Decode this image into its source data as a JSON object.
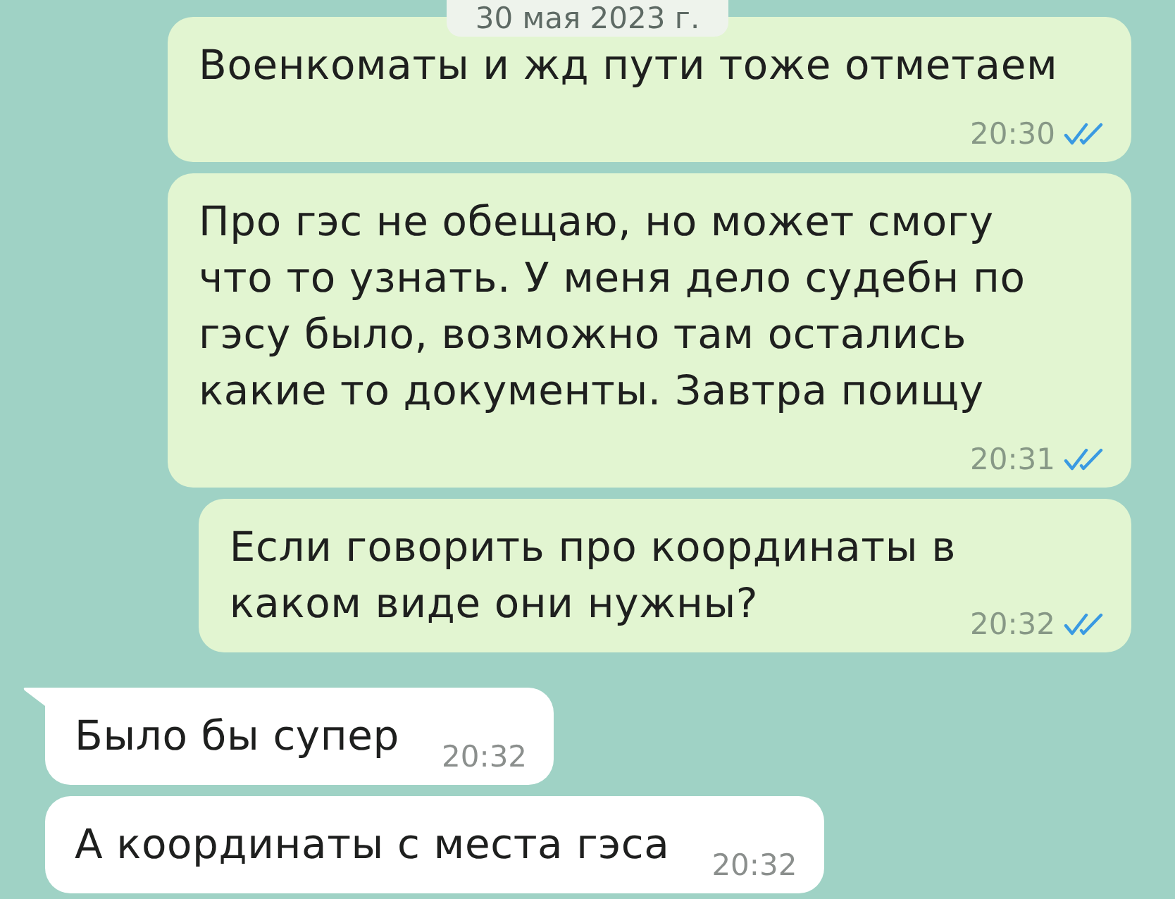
{
  "date_chip": {
    "text": "30 мая 2023 г."
  },
  "messages": [
    {
      "kind": "outgoing",
      "tail": false,
      "text": "Военкоматы и жд пути тоже отметаем",
      "time": "20:30",
      "read": true
    },
    {
      "kind": "outgoing",
      "tail": false,
      "text": "Про гэс не обещаю, но может смогу\nчто то узнать. У меня дело судебн по\nгэсу было, возможно там остались\nкакие то документы. Завтра поищу",
      "time": "20:31",
      "read": true
    },
    {
      "kind": "outgoing",
      "tail": false,
      "text": "Если говорить про координаты в\nкаком виде они нужны?",
      "time": "20:32",
      "read": true
    },
    {
      "kind": "incoming",
      "tail": true,
      "text": "Было бы супер",
      "time": "20:32"
    },
    {
      "kind": "incoming",
      "tail": false,
      "text": "А координаты с места гэса",
      "time": "20:32"
    }
  ]
}
